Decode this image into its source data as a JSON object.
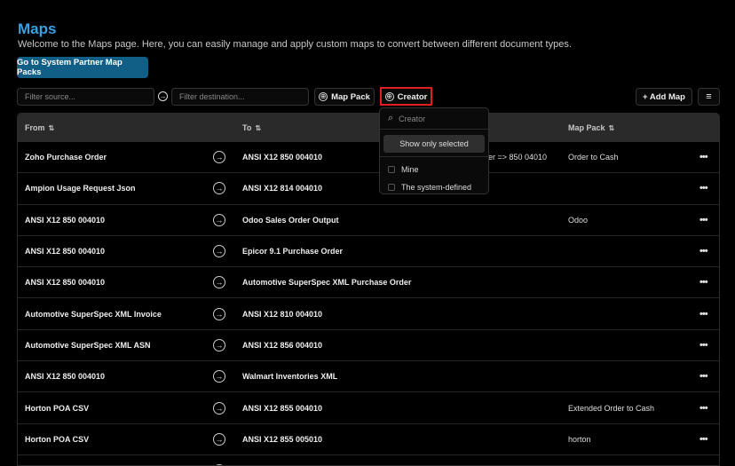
{
  "page": {
    "title": "Maps",
    "subtitle": "Welcome to the Maps page. Here, you can easily manage and apply custom maps to convert between different document types.",
    "primary_button": "Go to System Partner Map Packs"
  },
  "filters": {
    "source_placeholder": "Filter source...",
    "destination_placeholder": "Filter destination...",
    "map_pack_label": "Map Pack",
    "creator_label": "Creator",
    "add_map_label": "+ Add Map"
  },
  "icons": {
    "plus": "⊕",
    "arrow": "→",
    "more": "•••",
    "sort": "⇅",
    "search": "⌕",
    "filter": "≡"
  },
  "table": {
    "headers": {
      "from": "From",
      "to": "To",
      "map_pack": "Map Pack"
    },
    "rows": [
      {
        "from": "Zoho Purchase Order",
        "to": "ANSI X12 850 004010",
        "pack": "Order to Cash"
      },
      {
        "from": "Ampion Usage Request Json",
        "to": "ANSI X12 814 004010",
        "pack": ""
      },
      {
        "from": "ANSI X12 850 004010",
        "to": "Odoo Sales Order Output",
        "pack": "Odoo"
      },
      {
        "from": "ANSI X12 850 004010",
        "to": "Epicor 9.1 Purchase Order",
        "pack": ""
      },
      {
        "from": "ANSI X12 850 004010",
        "to": "Automotive SuperSpec XML Purchase Order",
        "pack": ""
      },
      {
        "from": "Automotive SuperSpec XML Invoice",
        "to": "ANSI X12 810 004010",
        "pack": ""
      },
      {
        "from": "Automotive SuperSpec XML ASN",
        "to": "ANSI X12 856 004010",
        "pack": ""
      },
      {
        "from": "ANSI X12 850 004010",
        "to": "Walmart Inventories XML",
        "pack": ""
      },
      {
        "from": "Horton POA CSV",
        "to": "ANSI X12 855 004010",
        "pack": "Extended Order to Cash"
      },
      {
        "from": "Horton POA CSV",
        "to": "ANSI X12 855 005010",
        "pack": "horton"
      }
    ],
    "partial_text": "er => 850 04010"
  },
  "dropdown": {
    "search_placeholder": "Creator",
    "show_selected": "Show only selected",
    "options": [
      "Mine",
      "The system-defined"
    ]
  },
  "colors": {
    "accent": "#3aa0e0",
    "primary_button": "#115e86",
    "highlight": "#e02020"
  }
}
